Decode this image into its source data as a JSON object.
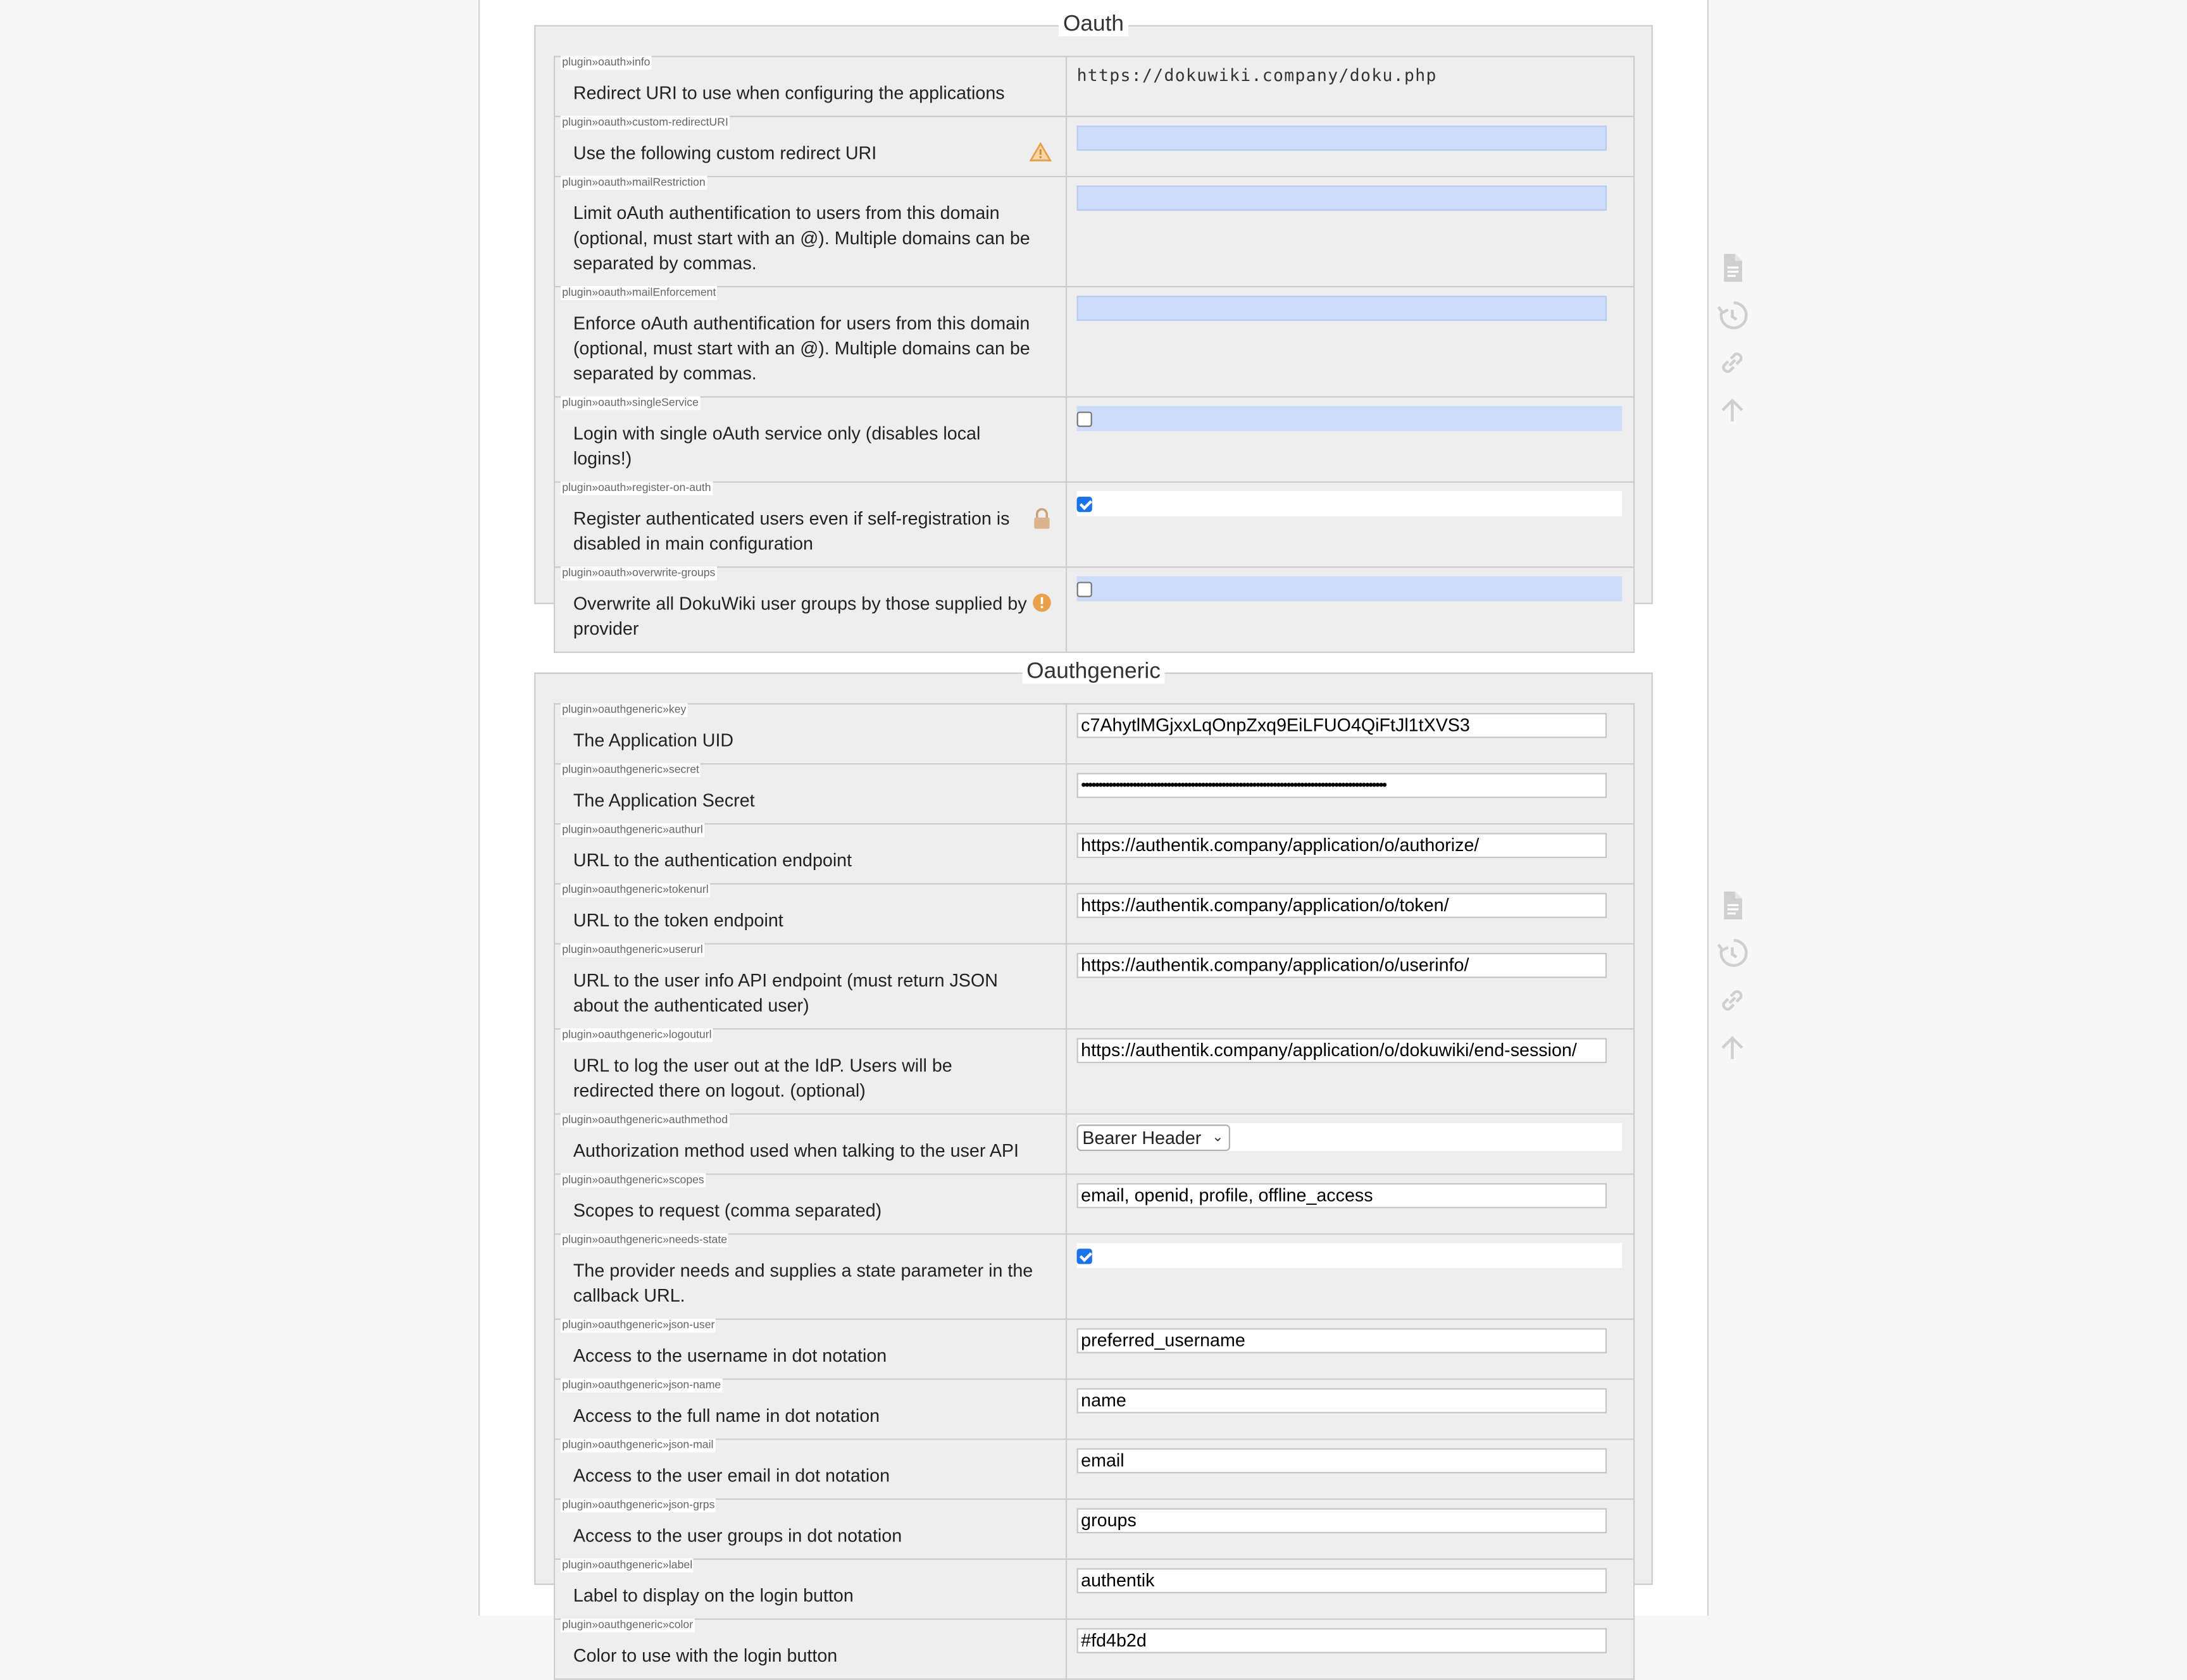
{
  "sections": {
    "oauth": {
      "title": "Oauth",
      "rows": [
        {
          "key": "plugin»oauth»info",
          "label": "Redirect URI to use when configuring the applications",
          "value": "https://dokuwiki.company/doku.php"
        },
        {
          "key": "plugin»oauth»custom-redirectURI",
          "label": "Use the following custom redirect URI",
          "value": "",
          "warning": "warning-triangle-icon"
        },
        {
          "key": "plugin»oauth»mailRestriction",
          "label": "Limit oAuth authentification to users from this domain (optional, must start with an @). Multiple domains can be separated by commas.",
          "value": ""
        },
        {
          "key": "plugin»oauth»mailEnforcement",
          "label": "Enforce oAuth authentification for users from this domain (optional, must start with an @). Multiple domains can be separated by commas.",
          "value": ""
        },
        {
          "key": "plugin»oauth»singleService",
          "label": "Login with single oAuth service only (disables local logins!)",
          "checked": false
        },
        {
          "key": "plugin»oauth»register-on-auth",
          "label": "Register authenticated users even if self-registration is disabled in main configuration",
          "checked": true,
          "warning": "lock-icon"
        },
        {
          "key": "plugin»oauth»overwrite-groups",
          "label": "Overwrite all DokuWiki user groups by those supplied by provider",
          "checked": false,
          "warning": "exclamation-circle-icon"
        }
      ]
    },
    "oauthgeneric": {
      "title": "Oauthgeneric",
      "rows": [
        {
          "key": "plugin»oauthgeneric»key",
          "label": "The Application UID",
          "value": "c7AhytlMGjxxLqOnpZxq9EiLFUO4QiFtJl1tXVS3"
        },
        {
          "key": "plugin»oauthgeneric»secret",
          "label": "The Application Secret",
          "value": "•••••••••••••••••••••••••••••••••••••••••••••••••••••••••••••••••••••••••••••••••••••••••"
        },
        {
          "key": "plugin»oauthgeneric»authurl",
          "label": "URL to the authentication endpoint",
          "value": "https://authentik.company/application/o/authorize/"
        },
        {
          "key": "plugin»oauthgeneric»tokenurl",
          "label": "URL to the token endpoint",
          "value": "https://authentik.company/application/o/token/"
        },
        {
          "key": "plugin»oauthgeneric»userurl",
          "label": "URL to the user info API endpoint (must return JSON about the authenticated user)",
          "value": "https://authentik.company/application/o/userinfo/"
        },
        {
          "key": "plugin»oauthgeneric»logouturl",
          "label": "URL to log the user out at the IdP. Users will be redirected there on logout. (optional)",
          "value": "https://authentik.company/application/o/dokuwiki/end-session/"
        },
        {
          "key": "plugin»oauthgeneric»authmethod",
          "label": "Authorization method used when talking to the user API",
          "value": "Bearer Header"
        },
        {
          "key": "plugin»oauthgeneric»scopes",
          "label": "Scopes to request (comma separated)",
          "value": "email, openid, profile, offline_access"
        },
        {
          "key": "plugin»oauthgeneric»needs-state",
          "label": "The provider needs and supplies a state parameter in the callback URL.",
          "checked": true
        },
        {
          "key": "plugin»oauthgeneric»json-user",
          "label": "Access to the username in dot notation",
          "value": "preferred_username"
        },
        {
          "key": "plugin»oauthgeneric»json-name",
          "label": "Access to the full name in dot notation",
          "value": "name"
        },
        {
          "key": "plugin»oauthgeneric»json-mail",
          "label": "Access to the user email in dot notation",
          "value": "email"
        },
        {
          "key": "plugin»oauthgeneric»json-grps",
          "label": "Access to the user groups in dot notation",
          "value": "groups"
        },
        {
          "key": "plugin»oauthgeneric»label",
          "label": "Label to display on the login button",
          "value": "authentik"
        },
        {
          "key": "plugin»oauthgeneric»color",
          "label": "Color to use with the login button",
          "value": "#fd4b2d"
        }
      ]
    }
  },
  "page_tools": [
    "page-icon",
    "history-icon",
    "link-icon",
    "arrow-up-icon"
  ],
  "colors": {
    "default_field": "#cddcfa",
    "field_border": "#c4c4c4",
    "checkbox_on": "#1a73e8",
    "warning": "#e8a04a"
  }
}
